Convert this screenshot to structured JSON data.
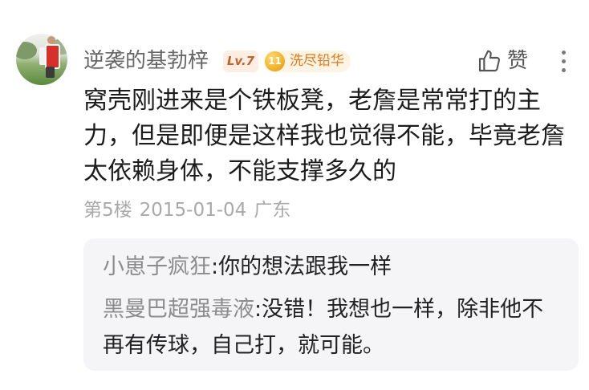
{
  "post": {
    "author": {
      "avatar_icon": "user-avatar",
      "name": "逆袭的基勃梓",
      "level": "Lv.7",
      "honor_badge": {
        "number": "11",
        "title": "洗尽铅华"
      }
    },
    "actions": {
      "like_icon": "thumbs-up-icon",
      "like_label": "赞",
      "more_icon": "more-vertical-icon"
    },
    "content_lines": [
      "窝壳刚进来是个铁板凳，老詹是常常打的主",
      "力，但是即便是这样我也觉得不能，毕竟老詹",
      "太依赖身体，不能支撑多久的"
    ],
    "meta": {
      "floor": "第5楼",
      "date": "2015-01-04",
      "location": "广东"
    },
    "replies": [
      {
        "author": "小崽子疯狂",
        "separator": ":",
        "text_lines": [
          "你的想法跟我一样"
        ]
      },
      {
        "author": "黑曼巴超强毒液",
        "separator": ":",
        "text_lines": [
          "没错！我想也一样，除非他不",
          "再有传球，自己打，就可能。"
        ]
      }
    ]
  },
  "colors": {
    "username": "#666666",
    "body_text": "#1c1c1c",
    "meta_text": "#a9a9a9",
    "level_badge_text": "#c2612a",
    "level_badge_bg": "#fdeee3",
    "honor_badge_text": "#e5781b",
    "honor_badge_bg": "#fef4e3",
    "honor_badge_coin": "#f0b429",
    "reply_author": "#8c8c8c",
    "reply_bg": "#f5f5f7"
  }
}
